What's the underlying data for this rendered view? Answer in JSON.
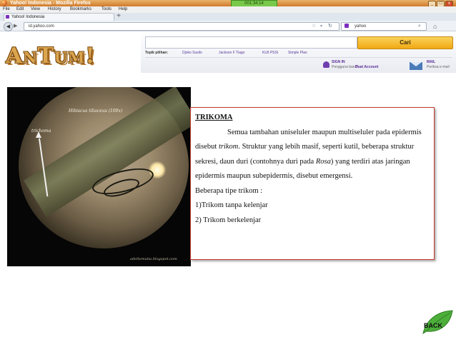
{
  "browser": {
    "window_title": "Yahoo! Indonesia - Mozilla Firefox",
    "timer": "001:34:14",
    "window_buttons": {
      "minimize": "_",
      "maximize": "□",
      "close": "x"
    },
    "menu": [
      "File",
      "Edit",
      "View",
      "History",
      "Bookmarks",
      "Tools",
      "Help"
    ],
    "tab_label": "Yahoo! Indonesia",
    "new_tab": "+",
    "url": "id.yahoo.com",
    "search_engine": "yahoo"
  },
  "yahoo": {
    "search_button": "Cari",
    "topics_label": "Topik pilihan:",
    "topics": [
      "Djoko Susilo",
      "Jackson F Tiago",
      "KLB PSSI",
      "Simple Plan"
    ],
    "signin_title": "SIGN IN",
    "signin_sub": "Pengguna baru?",
    "signin_link": "Buat Account",
    "mail_title": "MAIL",
    "mail_sub": "Periksa e-mail"
  },
  "logo": "AnTum!",
  "photo": {
    "species_label": "Hibiscus tiliaceus (100x)",
    "trichome_label": "trichoma",
    "watermark": "adeltemutia.blogspot.com"
  },
  "content": {
    "heading": "TRIKOMA",
    "para_1_a": "Semua tambahan uniseluler maupun multiseluler pada epidermis disebut ",
    "para_1_term": "trikom",
    "para_1_b": ". Struktur yang lebih masif, seperti kutil, beberapa struktur sekresi, daun duri (contohnya duri pada ",
    "para_1_genus": "Rosa",
    "para_1_c": ") yang terdiri atas jaringan epidermis maupun subepidermis, disebut emergensi.",
    "types_intro": "Beberapa tipe trikom :",
    "type_1": "1)Trikom tanpa kelenjar",
    "type_2": "2) Trikom berkelenjar"
  },
  "nav": {
    "back_label": "BACK"
  },
  "colors": {
    "accent_border": "#c0392b",
    "logo_gold": "#dba54f",
    "leaf_green": "#4caf3a",
    "firefox_titlebar": "#d07a2c"
  }
}
